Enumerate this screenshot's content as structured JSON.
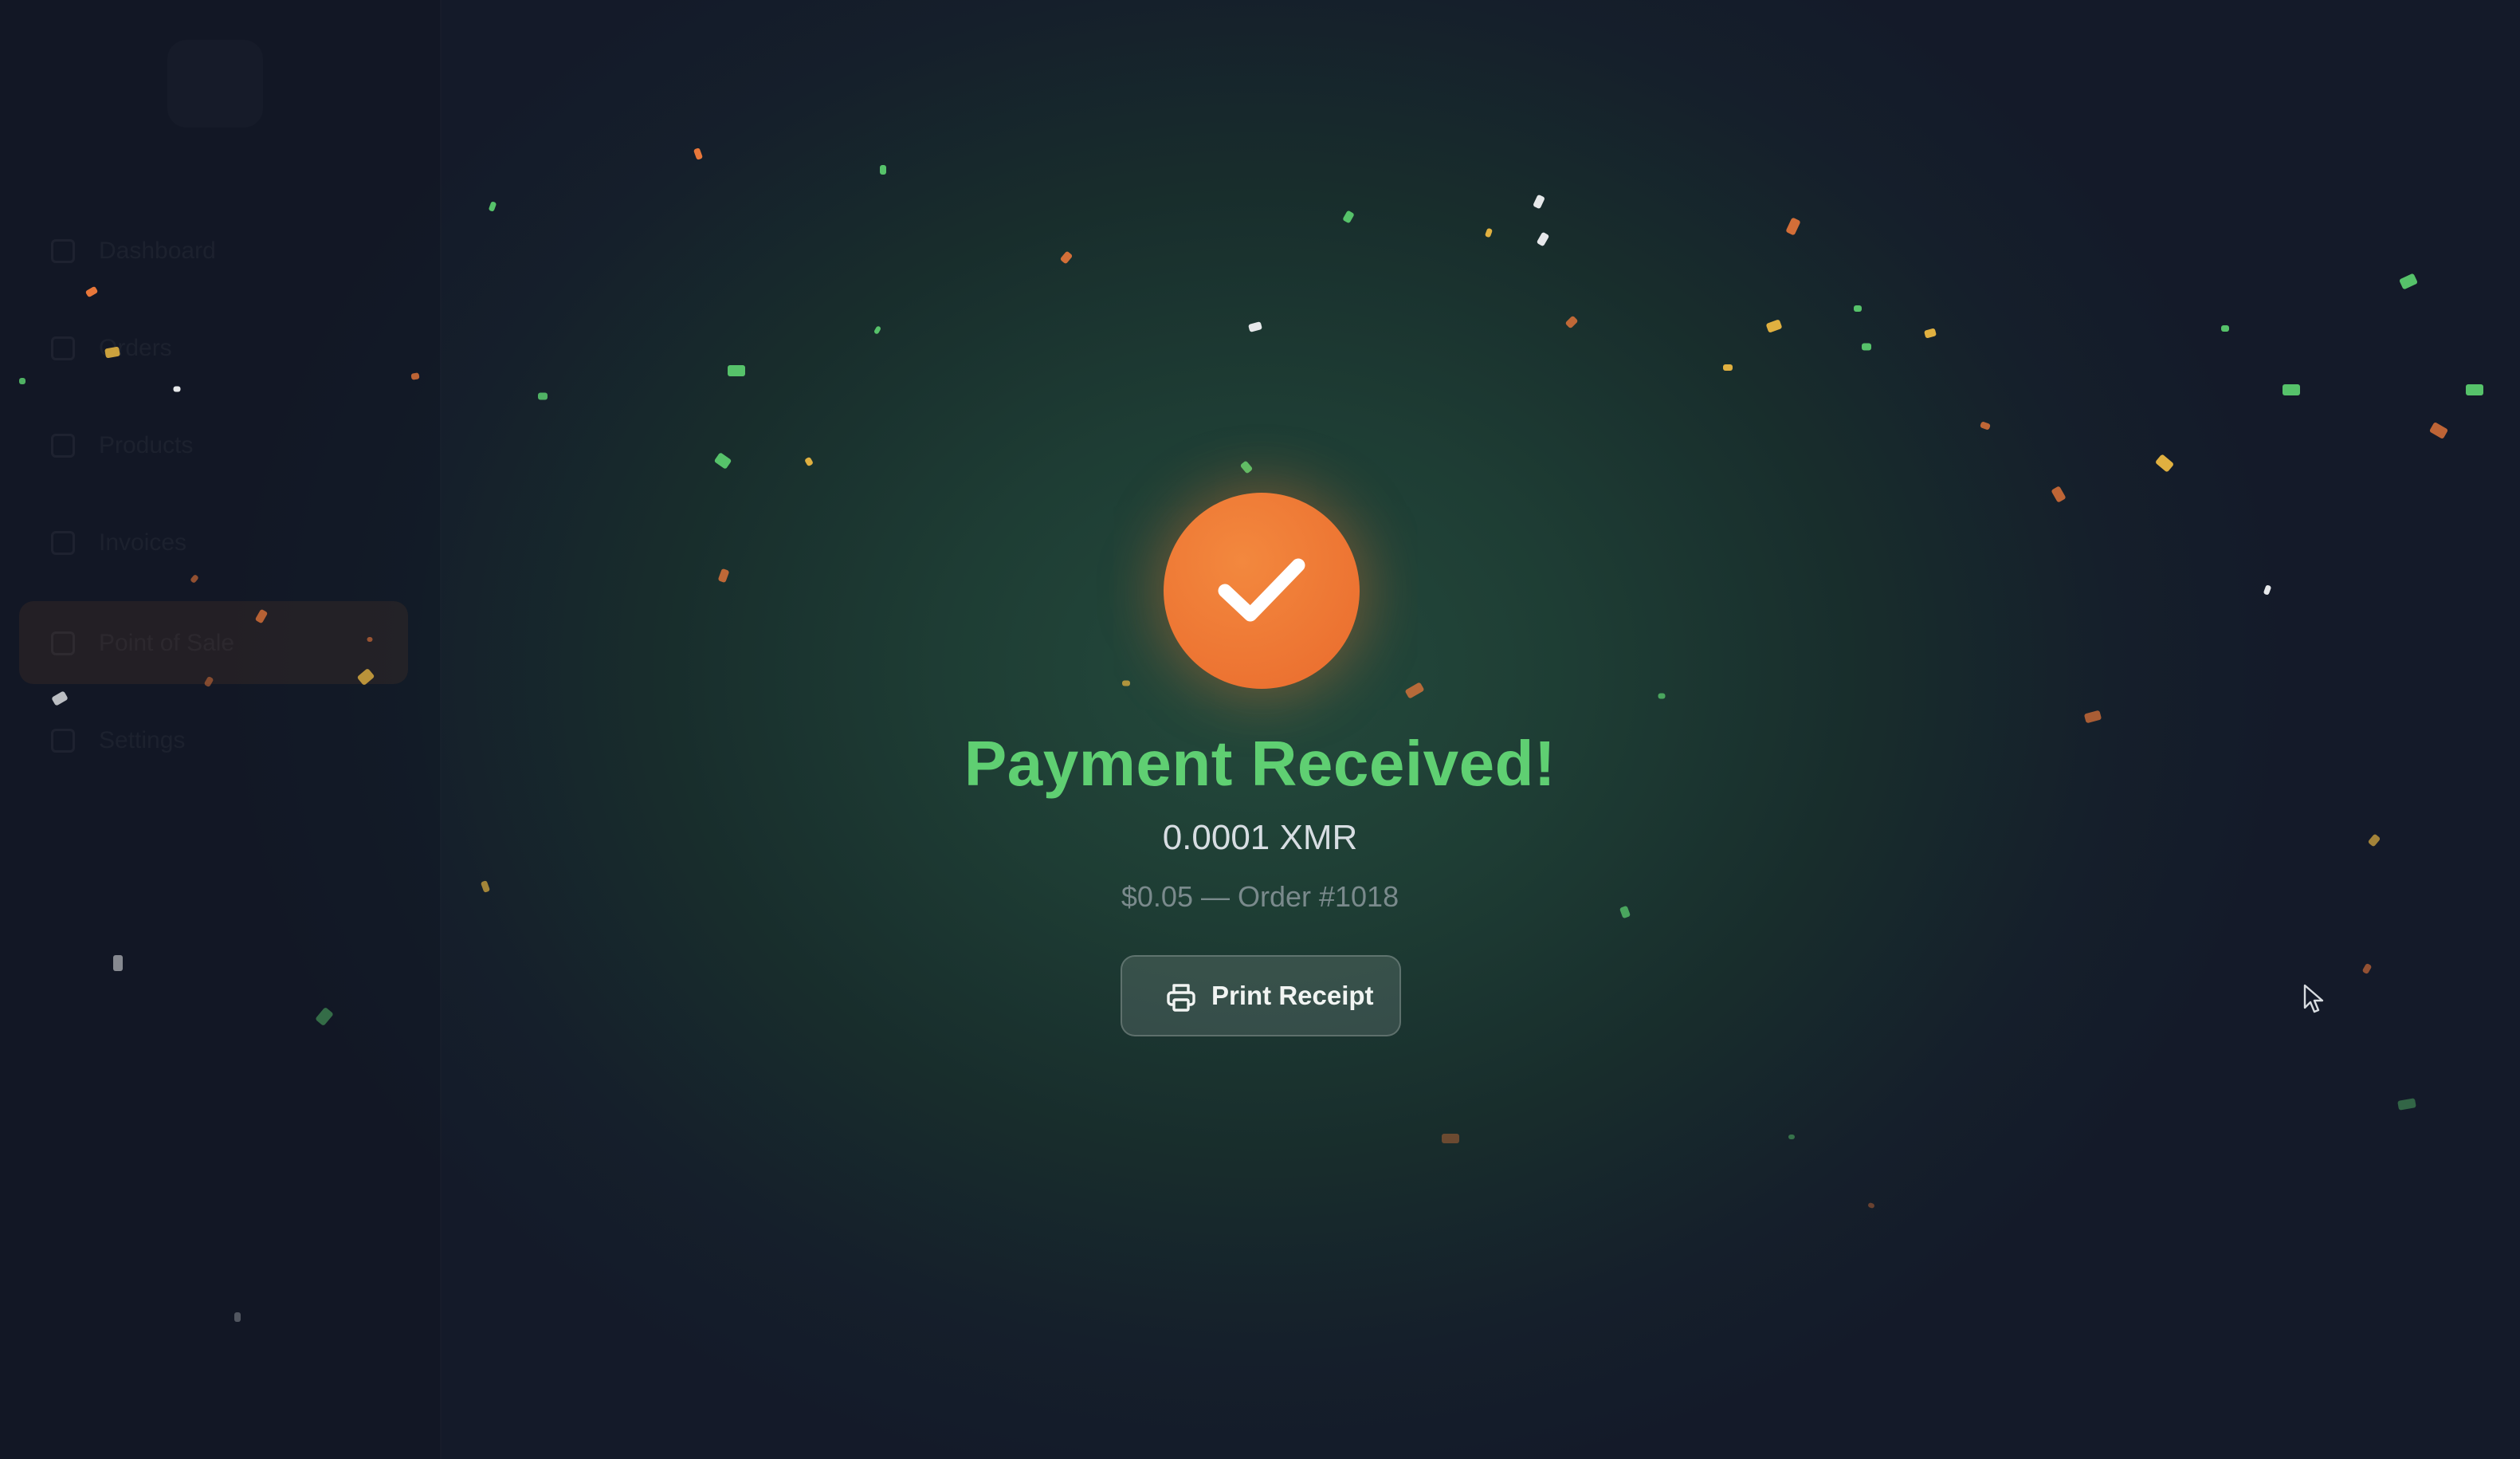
{
  "sidebar": {
    "items": [
      {
        "label": "Dashboard",
        "icon": "grid-icon"
      },
      {
        "label": "Orders",
        "icon": "receipt-icon"
      },
      {
        "label": "Products",
        "icon": "box-icon"
      },
      {
        "label": "Invoices",
        "icon": "file-icon"
      },
      {
        "label": "Point of Sale",
        "icon": "register-icon",
        "active": true
      },
      {
        "label": "Settings",
        "icon": "gear-icon"
      }
    ]
  },
  "status": {
    "icon": "check-icon",
    "title": "Payment Received!",
    "amount_crypto": "0.0001 XMR",
    "amount_fiat_order": "$0.05 — Order #1018"
  },
  "actions": {
    "print_label": "Print Receipt",
    "print_icon": "printer-icon"
  },
  "colors": {
    "accent_orange": "#ec7231",
    "success_green": "#5fcf72",
    "background": "#141a29",
    "confetti": [
      "#e8773a",
      "#56c26a",
      "#e0b040",
      "#e6e8ea"
    ]
  }
}
